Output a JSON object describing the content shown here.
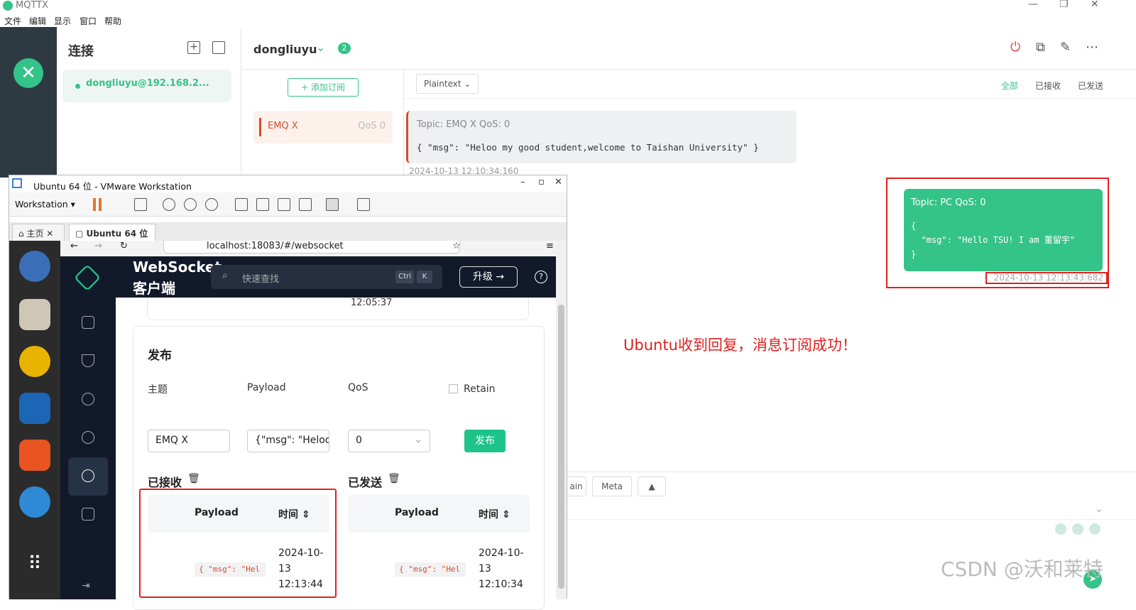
{
  "app": {
    "title": "MQTTX",
    "menu": [
      "文件",
      "编辑",
      "显示",
      "窗口",
      "帮助"
    ]
  },
  "connections": {
    "header": "连接",
    "items": [
      {
        "name": "dongliuyu@192.168.2..."
      }
    ]
  },
  "main": {
    "conn_name": "dongliuyu",
    "badge": "2",
    "add_sub_label": "+ 添加订阅",
    "subscriptions": [
      {
        "topic": "EMQ X",
        "qos": "QoS 0"
      }
    ],
    "payload_format": "Plaintext",
    "filters": [
      "全部",
      "已接收",
      "已发送"
    ],
    "received": {
      "topic_line": "Topic: EMQ X    QoS: 0",
      "payload": "{ \"msg\": \"Heloo my good student,welcome to Taishan University\" }",
      "time": "2024-10-13 12:10:34:160"
    },
    "sent": {
      "topic_line": "Topic: PC    QoS: 0",
      "payload": "{\n  \"msg\": \"Hello TSU! I am 董留宇\"\n}",
      "time": "2024-10-13 12:13:43:682"
    },
    "annotation": "Ubuntu收到回复，消息订阅成功！",
    "bottom_buttons": [
      "ain",
      "Meta",
      "▲"
    ],
    "watermark": "CSDN @沃和莱特"
  },
  "vmware": {
    "title": "Ubuntu 64 位 - VMware Workstation",
    "menu_label": "Workstation",
    "tabs": [
      "主页",
      "Ubuntu 64 位"
    ],
    "browser_url": "localhost:18083/#/websocket"
  },
  "emqx": {
    "brand_line1": "WebSocket",
    "brand_line2": "客户端",
    "search_placeholder": "快速查找",
    "search_key1": "Ctrl",
    "search_key2": "K",
    "upgrade_label": "升级 →",
    "help_label": "?",
    "prev_time": "12:05:37",
    "publish": {
      "heading": "发布",
      "topic_label": "主题",
      "topic_value": "EMQ X",
      "payload_label": "Payload",
      "payload_value": "{\"msg\": \"Heloo",
      "qos_label": "QoS",
      "qos_value": "0",
      "retain_label": "Retain",
      "publish_button": "发布"
    },
    "received": {
      "heading": "已接收",
      "col_payload": "Payload",
      "col_time": "时间",
      "rows": [
        {
          "payload": "{ \"msg\": \"Hel",
          "time": "2024-10-\n13\n12:13:44"
        }
      ]
    },
    "sent": {
      "heading": "已发送",
      "col_payload": "Payload",
      "col_time": "时间",
      "rows": [
        {
          "payload": "{ \"msg\": \"Hel",
          "time": "2024-10-\n13\n12:10:34"
        }
      ]
    }
  }
}
